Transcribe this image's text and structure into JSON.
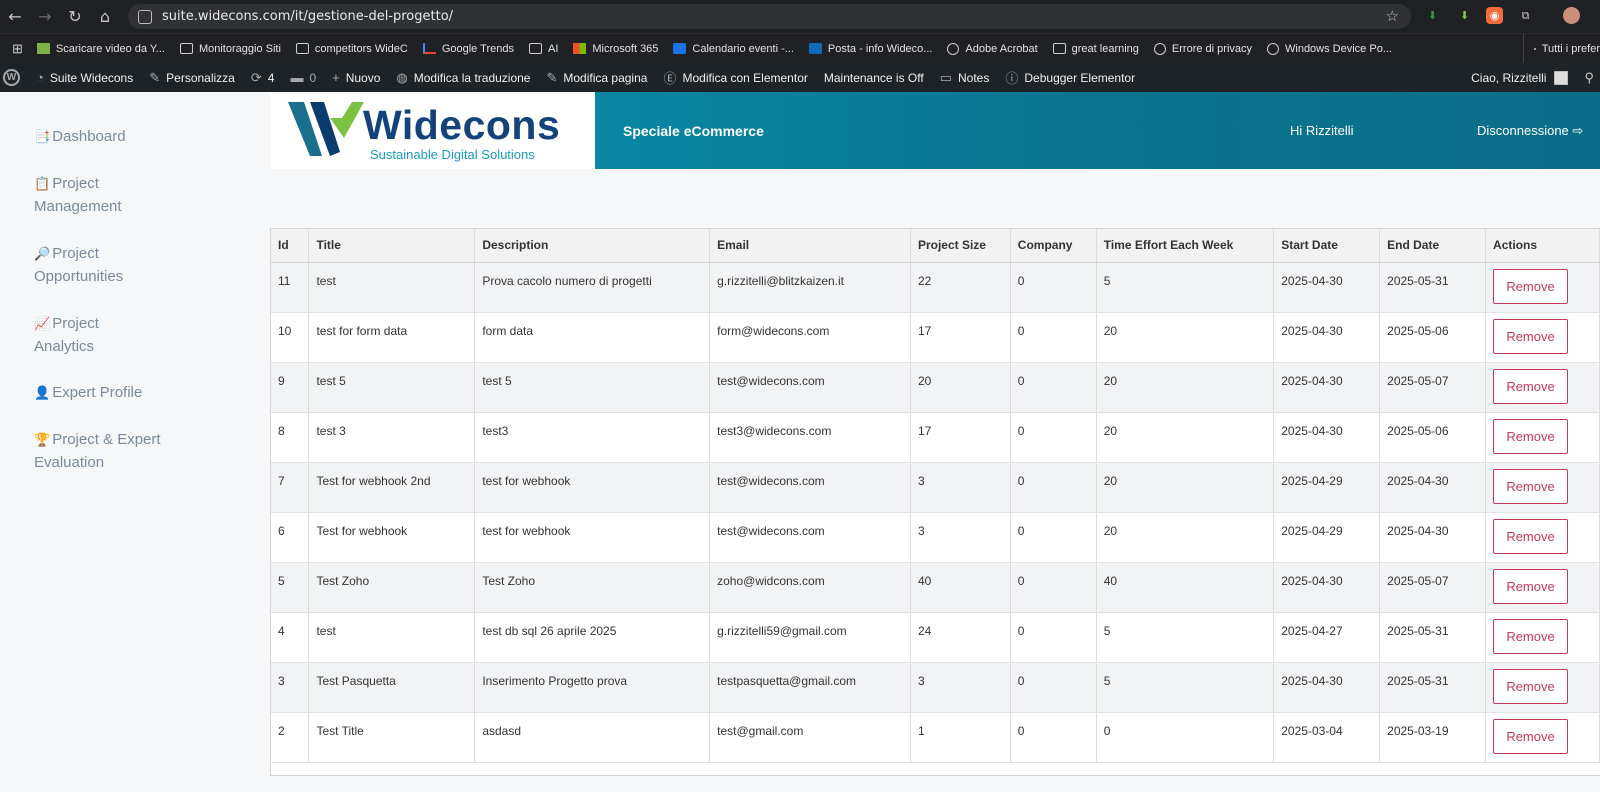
{
  "browser": {
    "url": "suite.widecons.com/it/gestione-del-progetto/",
    "bookmarks": [
      "Scaricare video da Y...",
      "Monitoraggio Siti",
      "competitors WideC",
      "Google Trends",
      "AI",
      "Microsoft 365",
      "Calendario eventi -...",
      "Posta - info Wideco...",
      "Adobe Acrobat",
      "great learning",
      "Errore di privacy",
      "Windows Device Po..."
    ],
    "bookmarks_right": "Tutti i prefer"
  },
  "wp_bar": {
    "site": "Suite Widecons",
    "customize": "Personalizza",
    "updates": "4",
    "comments": "0",
    "new": "Nuovo",
    "translate": "Modifica la traduzione",
    "edit_page": "Modifica pagina",
    "elementor_edit": "Modifica con Elementor",
    "maintenance": "Maintenance is Off",
    "notes": "Notes",
    "debugger": "Debugger Elementor",
    "greeting": "Ciao, Rizzitelli"
  },
  "sidebar": {
    "items": [
      {
        "icon": "📑",
        "label": "Dashboard"
      },
      {
        "icon": "📋",
        "label": "Project Management"
      },
      {
        "icon": "🔎",
        "label": "Project Opportunities"
      },
      {
        "icon": "📈",
        "label": "Project Analytics"
      },
      {
        "icon": "👤",
        "label": "Expert Profile"
      },
      {
        "icon": "🏆",
        "label": "Project & Expert Evaluation"
      }
    ]
  },
  "header": {
    "logo_name": "Widecons",
    "logo_tagline": "Sustainable Digital Solutions",
    "title": "Speciale eCommerce",
    "hi": "Hi Rizzitelli",
    "logout": "Disconnessione"
  },
  "table": {
    "columns": [
      "Id",
      "Title",
      "Description",
      "Email",
      "Project Size",
      "Company",
      "Time Effort Each Week",
      "Start Date",
      "End Date",
      "Actions"
    ],
    "action_label": "Remove",
    "rows": [
      [
        "11",
        "test",
        "Prova cacolo numero di progetti",
        "g.rizzitelli@blitzkaizen.it",
        "22",
        "0",
        "5",
        "2025-04-30",
        "2025-05-31"
      ],
      [
        "10",
        "test for form data",
        "form data",
        "form@widecons.com",
        "17",
        "0",
        "20",
        "2025-04-30",
        "2025-05-06"
      ],
      [
        "9",
        "test 5",
        "test 5",
        "test@widecons.com",
        "20",
        "0",
        "20",
        "2025-04-30",
        "2025-05-07"
      ],
      [
        "8",
        "test 3",
        "test3",
        "test3@widecons.com",
        "17",
        "0",
        "20",
        "2025-04-30",
        "2025-05-06"
      ],
      [
        "7",
        "Test for webhook 2nd",
        "test for webhook",
        "test@widecons.com",
        "3",
        "0",
        "20",
        "2025-04-29",
        "2025-04-30"
      ],
      [
        "6",
        "Test for webhook",
        "test for webhook",
        "test@widecons.com",
        "3",
        "0",
        "20",
        "2025-04-29",
        "2025-04-30"
      ],
      [
        "5",
        "Test Zoho",
        "Test Zoho",
        "zoho@widcons.com",
        "40",
        "0",
        "40",
        "2025-04-30",
        "2025-05-07"
      ],
      [
        "4",
        "test",
        "test db sql 26 aprile 2025",
        "g.rizzitelli59@gmail.com",
        "24",
        "0",
        "5",
        "2025-04-27",
        "2025-05-31"
      ],
      [
        "3",
        "Test Pasquetta",
        "Inserimento Progetto prova",
        "testpasquetta@gmail.com",
        "3",
        "0",
        "5",
        "2025-04-30",
        "2025-05-31"
      ],
      [
        "2",
        "Test Title",
        "asdasd",
        "test@gmail.com",
        "1",
        "0",
        "0",
        "2025-03-04",
        "2025-03-19"
      ]
    ]
  }
}
